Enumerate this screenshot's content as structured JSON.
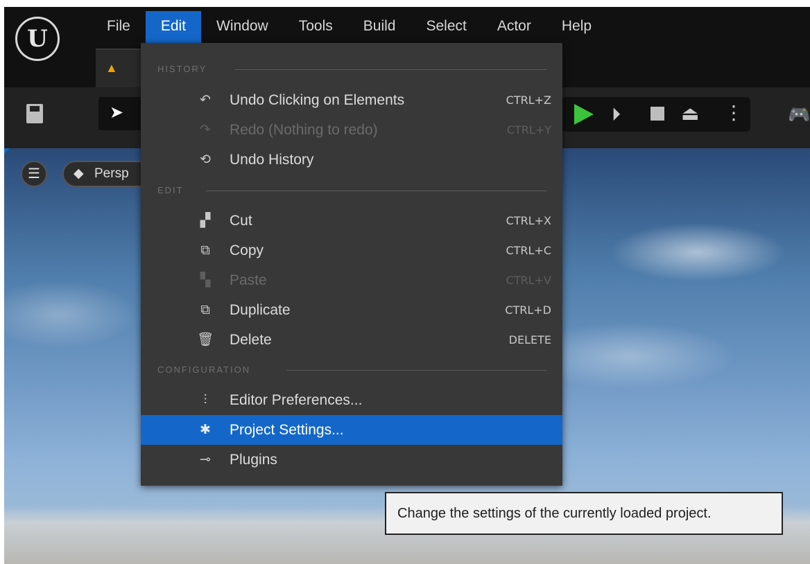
{
  "menubar": {
    "items": [
      {
        "label": "File"
      },
      {
        "label": "Edit"
      },
      {
        "label": "Window"
      },
      {
        "label": "Tools"
      },
      {
        "label": "Build"
      },
      {
        "label": "Select"
      },
      {
        "label": "Actor"
      },
      {
        "label": "Help"
      }
    ],
    "active_index": 1
  },
  "viewport": {
    "perspective_label": "Persp"
  },
  "edit_menu": {
    "sections": [
      {
        "header": "HISTORY",
        "items": [
          {
            "label": "Undo Clicking on Elements",
            "shortcut": "CTRL+Z",
            "icon": "undo-icon",
            "enabled": true
          },
          {
            "label": "Redo (Nothing to redo)",
            "shortcut": "CTRL+Y",
            "icon": "redo-icon",
            "enabled": false
          },
          {
            "label": "Undo History",
            "shortcut": "",
            "icon": "undo-history-icon",
            "enabled": true
          }
        ]
      },
      {
        "header": "EDIT",
        "items": [
          {
            "label": "Cut",
            "shortcut": "CTRL+X",
            "icon": "cut-icon",
            "enabled": true
          },
          {
            "label": "Copy",
            "shortcut": "CTRL+C",
            "icon": "copy-icon",
            "enabled": true
          },
          {
            "label": "Paste",
            "shortcut": "CTRL+V",
            "icon": "paste-icon",
            "enabled": false
          },
          {
            "label": "Duplicate",
            "shortcut": "CTRL+D",
            "icon": "duplicate-icon",
            "enabled": true
          },
          {
            "label": "Delete",
            "shortcut": "DELETE",
            "icon": "trash-icon",
            "enabled": true
          }
        ]
      },
      {
        "header": "CONFIGURATION",
        "items": [
          {
            "label": "Editor Preferences...",
            "shortcut": "",
            "icon": "sliders-icon",
            "enabled": true
          },
          {
            "label": "Project Settings...",
            "shortcut": "",
            "icon": "project-settings-icon",
            "enabled": true,
            "highlighted": true
          },
          {
            "label": "Plugins",
            "shortcut": "",
            "icon": "plug-icon",
            "enabled": true
          }
        ]
      }
    ]
  },
  "tooltip": {
    "text": "Change the settings of the currently loaded project."
  },
  "colors": {
    "accent": "#1467c9",
    "menu_bg": "#383838",
    "play_green": "#3cc33c"
  }
}
